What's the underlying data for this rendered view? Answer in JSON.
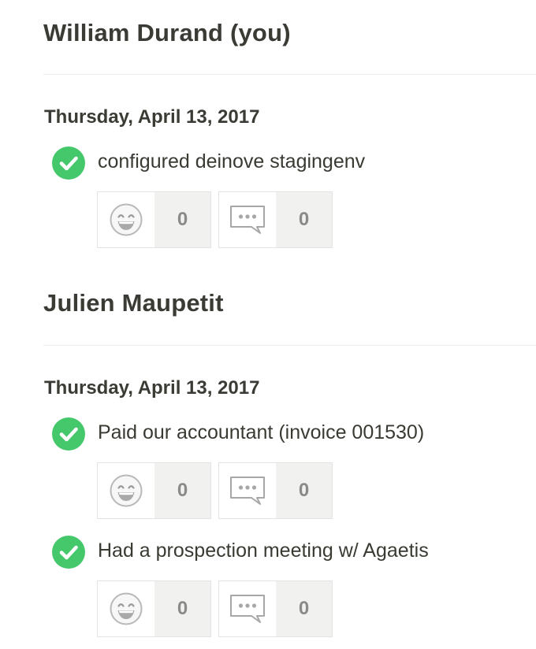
{
  "users": [
    {
      "name": "William Durand (you)",
      "date": "Thursday, April 13, 2017",
      "tasks": [
        {
          "text": "configured deinove stagingenv",
          "reactions": "0",
          "comments": "0"
        }
      ]
    },
    {
      "name": "Julien Maupetit",
      "date": "Thursday, April 13, 2017",
      "tasks": [
        {
          "text": "Paid our accountant (invoice 001530)",
          "reactions": "0",
          "comments": "0"
        },
        {
          "text": "Had a prospection meeting w/ Agaetis",
          "reactions": "0",
          "comments": "0"
        }
      ]
    }
  ],
  "colors": {
    "check": "#45c76b",
    "text": "#3b3b35",
    "count_bg": "#f1f1f0",
    "count_text": "#8a8a86",
    "divider": "#ececec"
  },
  "icons": {
    "done": "check-circle-icon",
    "reaction": "laughing-face-icon",
    "comment": "speech-bubble-icon"
  }
}
